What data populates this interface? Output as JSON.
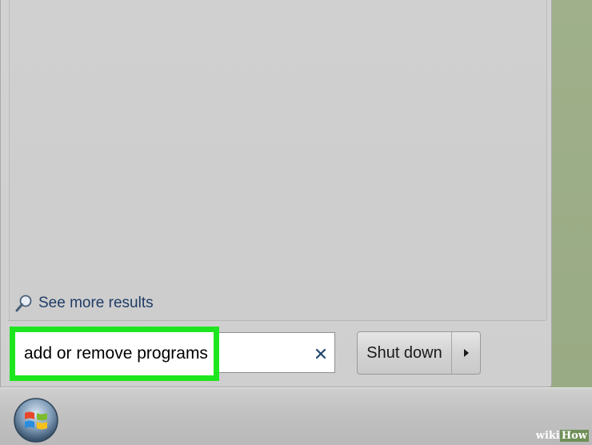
{
  "start_menu": {
    "see_more_results": "See more results",
    "search": {
      "value": "add or remove programs",
      "clear_icon": "close-icon"
    },
    "shutdown": {
      "label": "Shut down",
      "arrow_icon": "triangle-right-icon"
    }
  },
  "taskbar": {
    "start_orb_icon": "windows-logo-icon"
  },
  "watermark": {
    "wiki": "wiki",
    "how": "How"
  },
  "colors": {
    "highlight": "#1ee61e",
    "link_text": "#1f3c66",
    "desktop": "#9aab85"
  }
}
